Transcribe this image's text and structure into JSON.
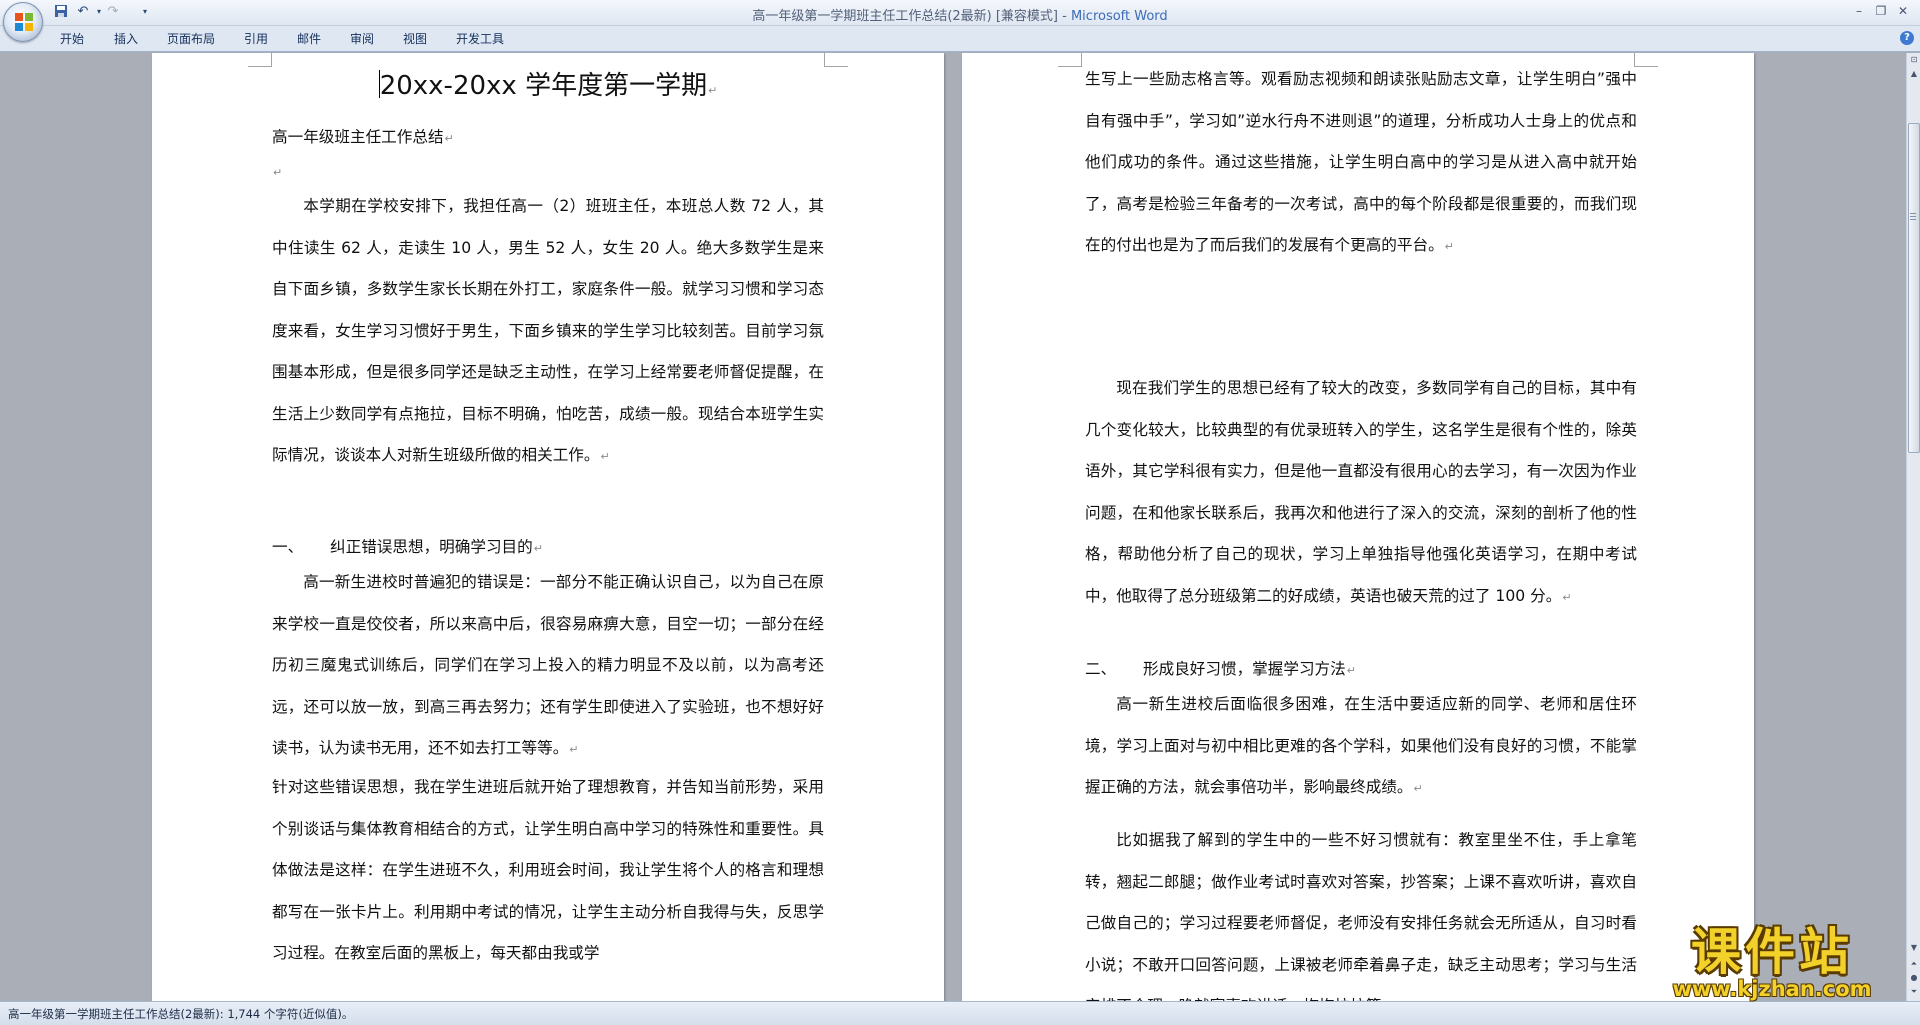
{
  "window": {
    "title": "高一年级第一学期班主任工作总结(2最新) [兼容模式] - ",
    "app_name": "Microsoft Word"
  },
  "qat": {
    "save_icon": "save-icon",
    "undo_icon": "undo-icon",
    "redo_icon": "redo-icon"
  },
  "ribbon_tabs": [
    "开始",
    "插入",
    "页面布局",
    "引用",
    "邮件",
    "审阅",
    "视图",
    "开发工具"
  ],
  "document": {
    "title": "20xx-20xx 学年度第一学期",
    "left_page": [
      {
        "id": "subtitle",
        "text": "高一年级班主任工作总结",
        "indent": false
      },
      {
        "id": "blank",
        "text": "",
        "indent": false
      },
      {
        "id": "p1",
        "text": "本学期在学校安排下，我担任高一（2）班班主任，本班总人数 72 人，其中住读生 62 人，走读生 10 人，男生 52 人，女生 20 人。绝大多数学生是来自下面乡镇，多数学生家长长期在外打工，家庭条件一般。就学习习惯和学习态度来看，女生学习习惯好于男生，下面乡镇来的学生学习比较刻苦。目前学习氛围基本形成，但是很多同学还是缺乏主动性，在学习上经常要老师督促提醒，在生活上少数同学有点拖拉，目标不明确，怕吃苦，成绩一般。现结合本班学生实际情况，谈谈本人对新生班级所做的相关工作。",
        "indent": true
      },
      {
        "id": "h1",
        "num": "一、",
        "text": "纠正错误思想，明确学习目的",
        "heading": true
      },
      {
        "id": "p2",
        "text": "高一新生进校时普遍犯的错误是：一部分不能正确认识自己，以为自己在原来学校一直是佼佼者，所以来高中后，很容易麻痹大意，目空一切；一部分在经历初三魔鬼式训练后，同学们在学习上投入的精力明显不及以前，以为高考还远，还可以放一放，到高三再去努力；还有学生即使进入了实验班，也不想好好读书，认为读书无用，还不如去打工等等。",
        "indent": true
      },
      {
        "id": "p3",
        "text": "针对这些错误思想，我在学生进班后就开始了理想教育，并告知当前形势，采用个别谈话与集体教育相结合的方式，让学生明白高中学习的特殊性和重要性。具体做法是这样：在学生进班不久，利用班会时间，我让学生将个人的格言和理想都写在一张卡片上。利用期中考试的情况，让学生主动分析自我得与失，反思学习过程。在教室后面的黑板上，每天都由我或学",
        "indent": false,
        "nomark": true
      }
    ],
    "right_page": [
      {
        "id": "r1",
        "text": "生写上一些励志格言等。观看励志视频和朗读张贴励志文章，让学生明白”强中自有强中手”，学习如”逆水行舟不进则退”的道理，分析成功人士身上的优点和他们成功的条件。通过这些措施，让学生明白高中的学习是从进入高中就开始了，高考是检验三年备考的一次考试，高中的每个阶段都是很重要的，而我们现在的付出也是为了而后我们的发展有个更高的平台。",
        "indent": false
      },
      {
        "id": "r2",
        "text": "现在我们学生的思想已经有了较大的改变，多数同学有自己的目标，其中有几个变化较大，比较典型的有优录班转入的学生，这名学生是很有个性的，除英语外，其它学科很有实力，但是他一直都没有很用心的去学习，有一次因为作业问题，在和他家长联系后，我再次和他进行了深入的交流，深刻的剖析了他的性格，帮助他分析了自己的现状，学习上单独指导他强化英语学习，在期中考试中，他取得了总分班级第二的好成绩，英语也破天荒的过了 100 分。",
        "indent": true
      },
      {
        "id": "h2",
        "num": "二、",
        "text": "形成良好习惯，掌握学习方法",
        "heading": true
      },
      {
        "id": "r3",
        "text": "高一新生进校后面临很多困难，在生活中要适应新的同学、老师和居住环境，学习上面对与初中相比更难的各个学科，如果他们没有良好的习惯，不能掌握正确的方法，就会事倍功半，影响最终成绩。",
        "indent": true
      },
      {
        "id": "r4",
        "text": "比如据我了解到的学生中的一些不好习惯就有：教室里坐不住，手上拿笔转，翘起二郎腿；做作业考试时喜欢对答案，抄答案；上课不喜欢听讲，喜欢自己做自己的；学习过程要老师督促，老师没有安排任务就会无所适从，自习时看小说；不敢开口回答问题，上课被老师牵着鼻子走，缺乏主动思考；学习与生活安排不合理，晚就寝喜欢讲话，拖拖拉拉等。",
        "indent": true
      }
    ]
  },
  "status": {
    "text": "高一年级第一学期班主任工作总结(2最新): 1,744 个字符(近似值)。"
  },
  "watermark": {
    "main": "课件站",
    "url": "www.kjzhan.com"
  }
}
